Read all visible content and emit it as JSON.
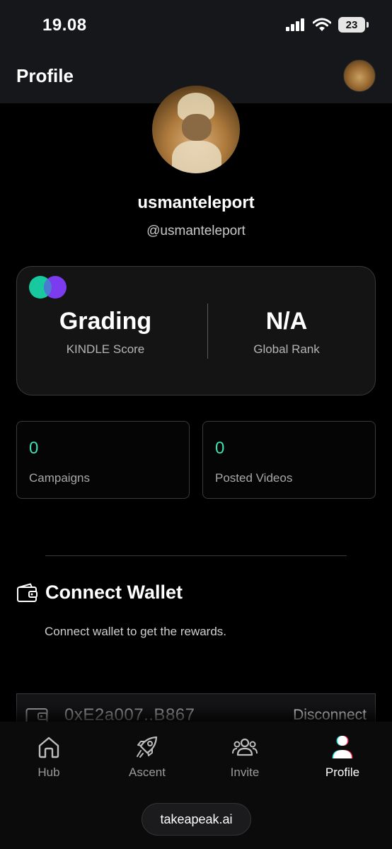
{
  "status_bar": {
    "time": "19.08",
    "battery": "23"
  },
  "header": {
    "title": "Profile"
  },
  "profile": {
    "username": "usmanteleport",
    "handle": "@usmanteleport"
  },
  "score_card": {
    "score_value": "Grading",
    "score_label": "KINDLE Score",
    "rank_value": "N/A",
    "rank_label": "Global Rank"
  },
  "stats": [
    {
      "value": "0",
      "label": "Campaigns"
    },
    {
      "value": "0",
      "label": "Posted Videos"
    }
  ],
  "wallet": {
    "heading": "Connect Wallet",
    "subtitle": "Connect wallet to get the rewards.",
    "address": "0xE2a007..B867",
    "disconnect_label": "Disconnect"
  },
  "nav": [
    {
      "label": "Hub",
      "icon": "home-icon"
    },
    {
      "label": "Ascent",
      "icon": "rocket-icon"
    },
    {
      "label": "Invite",
      "icon": "users-icon"
    },
    {
      "label": "Profile",
      "icon": "profile-icon",
      "active": true
    }
  ],
  "browser": {
    "url": "takeapeak.ai"
  },
  "colors": {
    "accent_green": "#3fe0b0",
    "logo_teal": "#18c9a0",
    "logo_purple": "#7b3cf0"
  }
}
